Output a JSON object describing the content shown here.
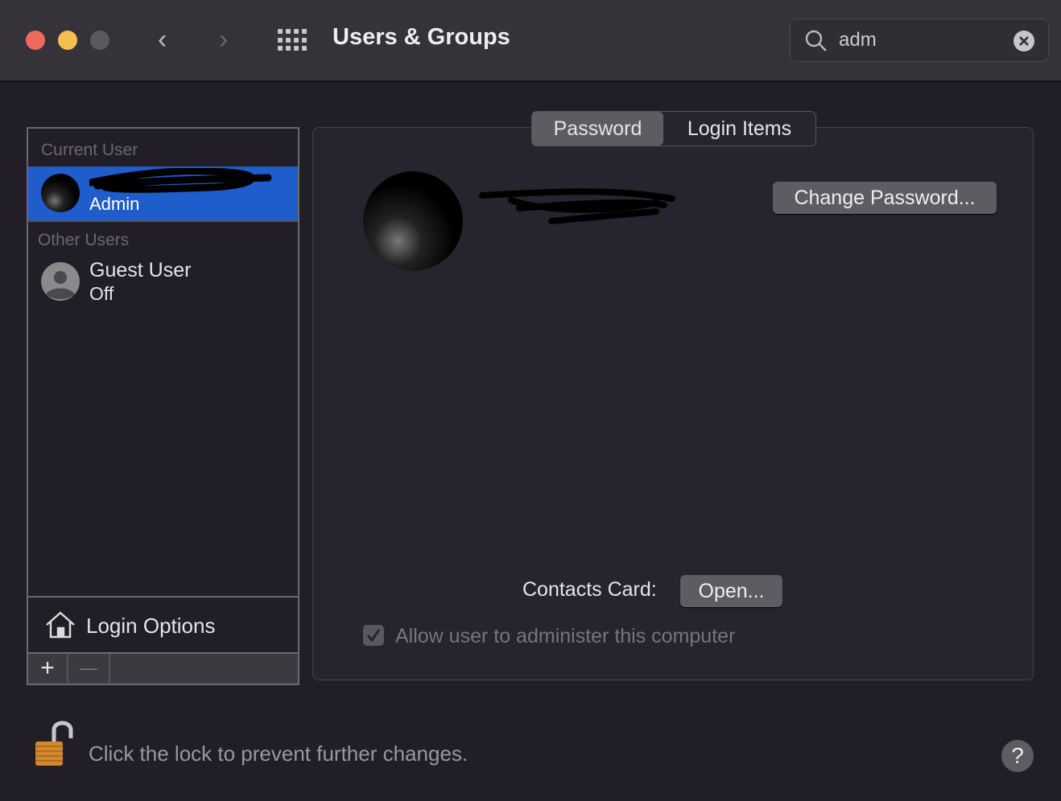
{
  "window": {
    "title": "Users & Groups"
  },
  "search": {
    "value": "adm"
  },
  "sidebar": {
    "current_user_header": "Current User",
    "current_user": {
      "role": "Admin"
    },
    "other_users_header": "Other Users",
    "guest": {
      "name": "Guest User",
      "status": "Off"
    },
    "login_options": "Login Options",
    "add": "+",
    "remove": "—"
  },
  "tabs": [
    {
      "label": "Password",
      "selected": true
    },
    {
      "label": "Login Items",
      "selected": false
    }
  ],
  "main": {
    "change_password": "Change Password...",
    "contacts_label": "Contacts Card:",
    "open_button": "Open...",
    "admin_checkbox": {
      "label": "Allow user to administer this computer",
      "checked": true,
      "disabled": true
    }
  },
  "footer": {
    "lock_text": "Click the lock to prevent further changes.",
    "help": "?"
  },
  "colors": {
    "accent": "#1f5ccc",
    "close": "#ee6a5f",
    "minimize": "#f5be4f"
  }
}
